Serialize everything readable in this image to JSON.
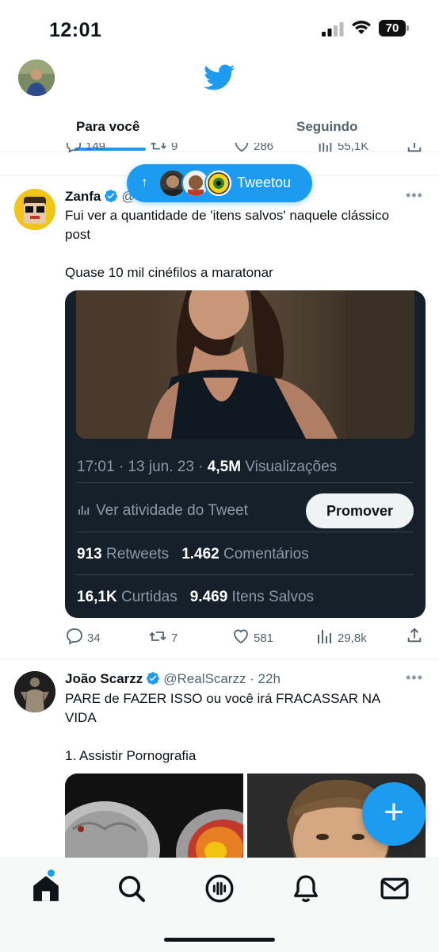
{
  "status_bar": {
    "time": "12:01",
    "battery": "70"
  },
  "header": {
    "tabs": [
      {
        "label": "Para você",
        "active": true
      },
      {
        "label": "Seguindo",
        "active": false
      }
    ]
  },
  "prev_tweet_actions": {
    "replies": "149",
    "retweets": "9",
    "likes": "286",
    "views": "55,1K"
  },
  "new_tweets_pill": {
    "label": "Tweetou"
  },
  "tweet1": {
    "name": "Zanfa",
    "handle": "@",
    "text_line1": "Fui ver a quantidade de 'itens salvos' naquele clássico post",
    "text_line2": "Quase 10 mil cinéfilos a maratonar",
    "card": {
      "time": "17:01 · 13 jun. 23 · ",
      "views_count": "4,5M",
      "views_label": " Visualizações",
      "activity_label": "Ver atividade do Tweet",
      "promote_label": "Promover",
      "retweets_count": "913",
      "retweets_label": " Retweets",
      "comments_count": "1.462",
      "comments_label": " Comentários",
      "likes_count": "16,1K",
      "likes_label": " Curtidas",
      "saved_count": "9.469",
      "saved_label": " Itens Salvos"
    },
    "actions": {
      "replies": "34",
      "retweets": "7",
      "likes": "581",
      "views": "29,8k"
    }
  },
  "tweet2": {
    "name": "João Scarzz",
    "handle": "@RealScarzz · 22h",
    "text_line1": "PARE de FAZER ISSO ou você irá FRACASSAR NA VIDA",
    "text_line2": "1. Assistir Pornografia"
  },
  "colors": {
    "accent": "#1d9bf0",
    "card_bg": "#15202b",
    "text": "#0f1419",
    "muted": "#536471"
  }
}
